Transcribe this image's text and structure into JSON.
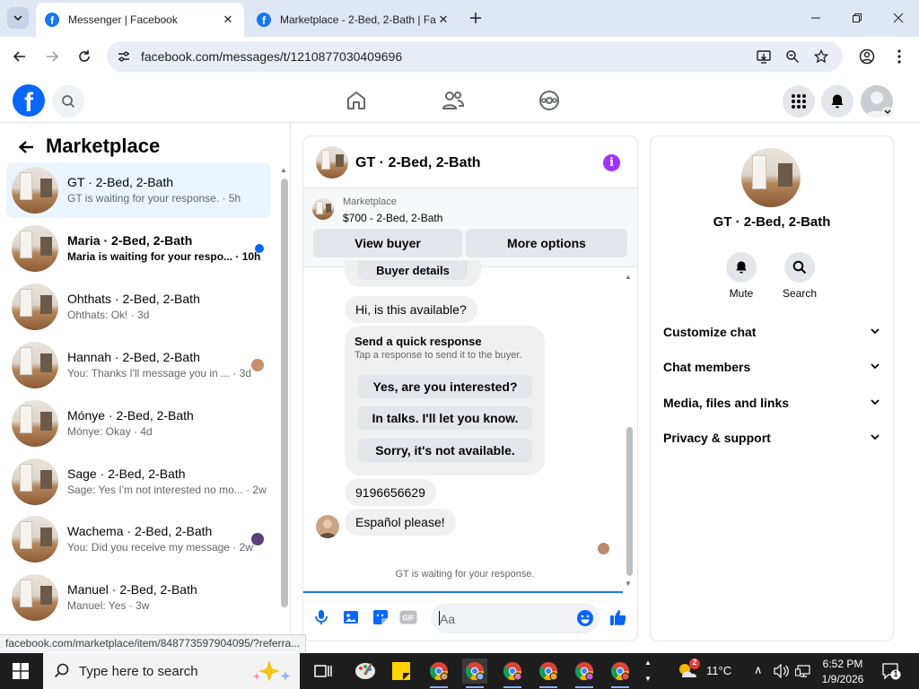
{
  "browser": {
    "tabs": [
      {
        "title": "Messenger | Facebook",
        "active": true
      },
      {
        "title": "Marketplace - 2-Bed, 2-Bath | Fa",
        "active": false
      }
    ],
    "url": "facebook.com/messages/t/1210877030409696",
    "status_link": "facebook.com/marketplace/item/848773597904095/?referra..."
  },
  "left_panel": {
    "title": "Marketplace",
    "conversations": [
      {
        "name": "GT · 2-Bed, 2-Bath",
        "preview": "GT is waiting for your response. · 5h",
        "active": true,
        "unread": false
      },
      {
        "name": "Maria · 2-Bed, 2-Bath",
        "preview": "Maria is waiting for your respo... · 10h",
        "active": false,
        "unread": true
      },
      {
        "name": "Ohthats · 2-Bed, 2-Bath",
        "preview": "Ohthats: Ok! · 3d",
        "active": false,
        "unread": false
      },
      {
        "name": "Hannah · 2-Bed, 2-Bath",
        "preview": "You: Thanks I'll message you in ... · 3d",
        "active": false,
        "unread": false
      },
      {
        "name": "Mónye · 2-Bed, 2-Bath",
        "preview": "Mónye: Okay · 4d",
        "active": false,
        "unread": false
      },
      {
        "name": "Sage · 2-Bed, 2-Bath",
        "preview": "Sage: Yes I'm not interested no mo... · 2w",
        "active": false,
        "unread": false
      },
      {
        "name": "Wachema · 2-Bed, 2-Bath",
        "preview": "You: Did you receive my message · 2w",
        "active": false,
        "unread": false
      },
      {
        "name": "Manuel · 2-Bed, 2-Bath",
        "preview": "Manuel: Yes · 3w",
        "active": false,
        "unread": false
      }
    ]
  },
  "chat": {
    "title": "GT · 2-Bed, 2-Bath",
    "listing": {
      "category": "Marketplace",
      "price_title": "$700 - 2-Bed, 2-Bath"
    },
    "view_buyer": "View buyer",
    "more_options": "More options",
    "buyer_details": "Buyer details",
    "msg_available": "Hi, is this available?",
    "quick_response": {
      "heading": "Send a quick response",
      "subtitle": "Tap a response to send it to the buyer.",
      "options": [
        "Yes, are you interested?",
        "In talks. I'll let you know.",
        "Sorry, it's not available."
      ]
    },
    "msg_phone": "9196656629",
    "msg_espanol": "Español please!",
    "waiting_status": "GT is waiting for your response.",
    "composer_placeholder": "Aa"
  },
  "right_panel": {
    "name": "GT · 2-Bed, 2-Bath",
    "mute_label": "Mute",
    "search_label": "Search",
    "sections": [
      "Customize chat",
      "Chat members",
      "Media, files and links",
      "Privacy & support"
    ]
  },
  "taskbar": {
    "search_placeholder": "Type here to search",
    "weather": "11°C",
    "time": "6:52 PM",
    "date": "1/9/2026",
    "notifications": "1",
    "weather_badge": "2"
  },
  "colors": {
    "fb_blue": "#0866ff",
    "messenger_purple": "#a033ff",
    "active_bg": "#ebf5ff"
  }
}
